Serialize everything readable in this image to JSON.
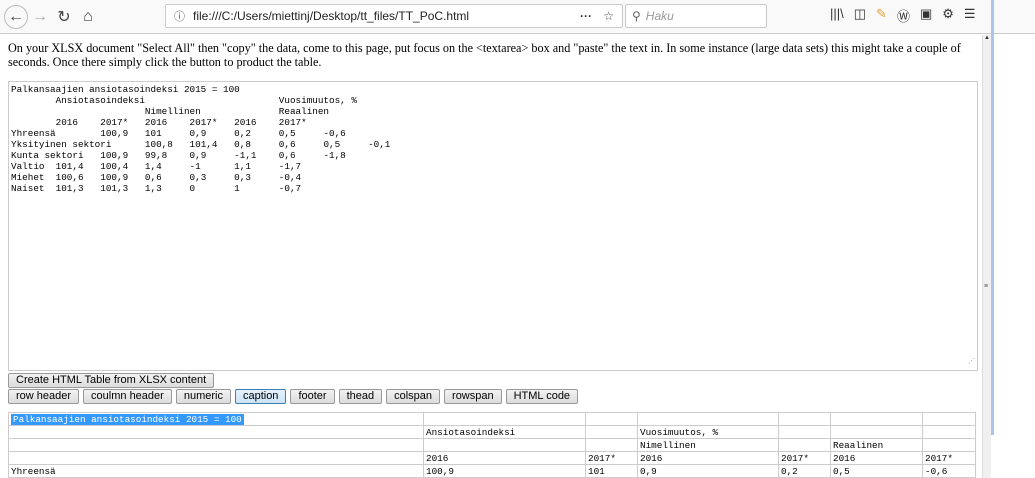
{
  "browser": {
    "url": "file:///C:/Users/miettinj/Desktop/tt_files/TT_PoC.html",
    "search_placeholder": "Haku"
  },
  "intro": "On your XLSX document \"Select All\" then \"copy\" the data, come to this page, put focus on the <textarea> box and \"paste\" the text in. In some instance (large data sets) this might take a couple of seconds. Once there simply click the button to product the table.",
  "textarea_value": "Palkansaajien ansiotasoindeksi 2015 = 100\n\tAnsiotasoindeksi\t\t\tVuosimuutos, %\n\t\t\tNimellinen\t\tReaalinen\n\t2016\t2017*\t2016\t2017*\t2016\t2017*\nYhreensä\t100,9\t101\t0,9\t0,2\t0,5\t-0,6\nYksityinen sektori\t100,8\t101,4\t0,8\t0,6\t0,5\t-0,1\nKunta sektori\t100,9\t99,8\t0,9\t-1,1\t0,6\t-1,8\nValtio\t101,4\t100,4\t1,4\t-1\t1,1\t-1,7\nMiehet\t100,6\t100,9\t0,6\t0,3\t0,3\t-0,4\nNaiset\t101,3\t101,3\t1,3\t0\t1\t-0,7",
  "create_button": "Create HTML Table from XLSX content",
  "option_buttons": [
    "row header",
    "coulmn header",
    "numeric",
    "caption",
    "footer",
    "thead",
    "colspan",
    "rowspan",
    "HTML code"
  ],
  "selected_option": "caption",
  "table": {
    "caption": "Palkansaajien ansiotasoindeksi 2015 = 100",
    "rows": [
      [
        "",
        "Ansiotasoindeksi",
        "",
        "Vuosimuutos, %",
        "",
        "",
        ""
      ],
      [
        "",
        "",
        "",
        "Nimellinen",
        "",
        "Reaalinen",
        ""
      ],
      [
        "",
        "2016",
        "2017*",
        "2016",
        "2017*",
        "2016",
        "2017*"
      ],
      [
        "Yhreensä",
        "100,9",
        "101",
        "0,9",
        "0,2",
        "0,5",
        "-0,6"
      ]
    ]
  }
}
